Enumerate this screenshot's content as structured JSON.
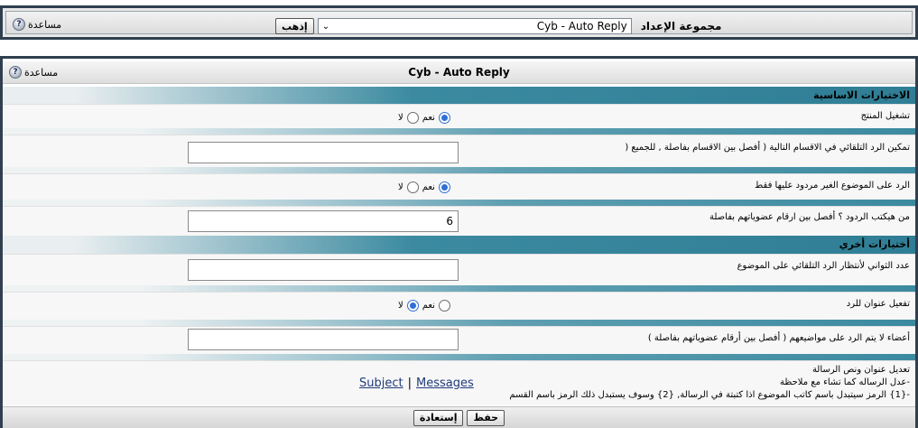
{
  "top_bar": {
    "help_label": "مساعدة",
    "group_label": "مجموعة الإعداد",
    "selected_group": "Cyb - Auto Reply",
    "go_label": "إذهب"
  },
  "main": {
    "title": "Cyb - Auto Reply",
    "help_label": "مساعدة",
    "section_basic": "الاختيارات الاساسية",
    "section_other": "أختيارات أخري",
    "yes": "نعم",
    "no": "لا",
    "options": {
      "enable": "تشغيل المنتج",
      "forums": "تمكين الرد التلقائي في الاقسام التالية ( أفصل بين الاقسام بفاصلة , للجميع (",
      "forums_value": "",
      "unreplied": "الرد على الموضوع الغير مردود عليها فقط",
      "who_replies": "من هيكتب الردود ؟ أفصل بين ارقام عضوياتهم بفاصلة",
      "who_replies_value": "6",
      "wait_seconds": "عدد الثواني لأنتظار الرد التلقائي على الموضوع",
      "wait_seconds_value": "",
      "reply_title": "تفعيل عنوان للرد",
      "excluded_members": "أعضاء لا يتم الرد على مواضيعهم ( أفصل بين أرقام عضوياتهم بفاصلة )",
      "excluded_members_value": "",
      "edit_title_1": "تعديل عنوان ونص الرسالة",
      "edit_title_2": "-عدل الرساله كما تشاء مع ملاحظة",
      "edit_title_3": "-{1} الرمز سيتبدل باسم كاتب الموضوع اذا كتبتة في الرسالة, {2} وسوف يستبدل ذلك الرمز باسم القسم",
      "subject_link": "Subject",
      "link_sep": "|",
      "messages_link": "Messages"
    },
    "save_label": "حفظ",
    "reset_label": "إستعادة"
  }
}
